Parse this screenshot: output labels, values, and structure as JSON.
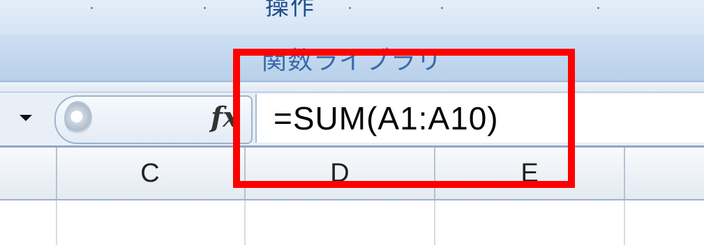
{
  "ribbon": {
    "cut_label": "操作",
    "group_label": "関数ライブラリ"
  },
  "formula_bar": {
    "fx_label": "fx",
    "formula": "=SUM(A1:A10)"
  },
  "columns": [
    "C",
    "D",
    "E"
  ],
  "annotation": {
    "highlight_color": "#ff0000"
  },
  "icons": [
    "dropdown-arrow-icon",
    "fx-icon"
  ]
}
